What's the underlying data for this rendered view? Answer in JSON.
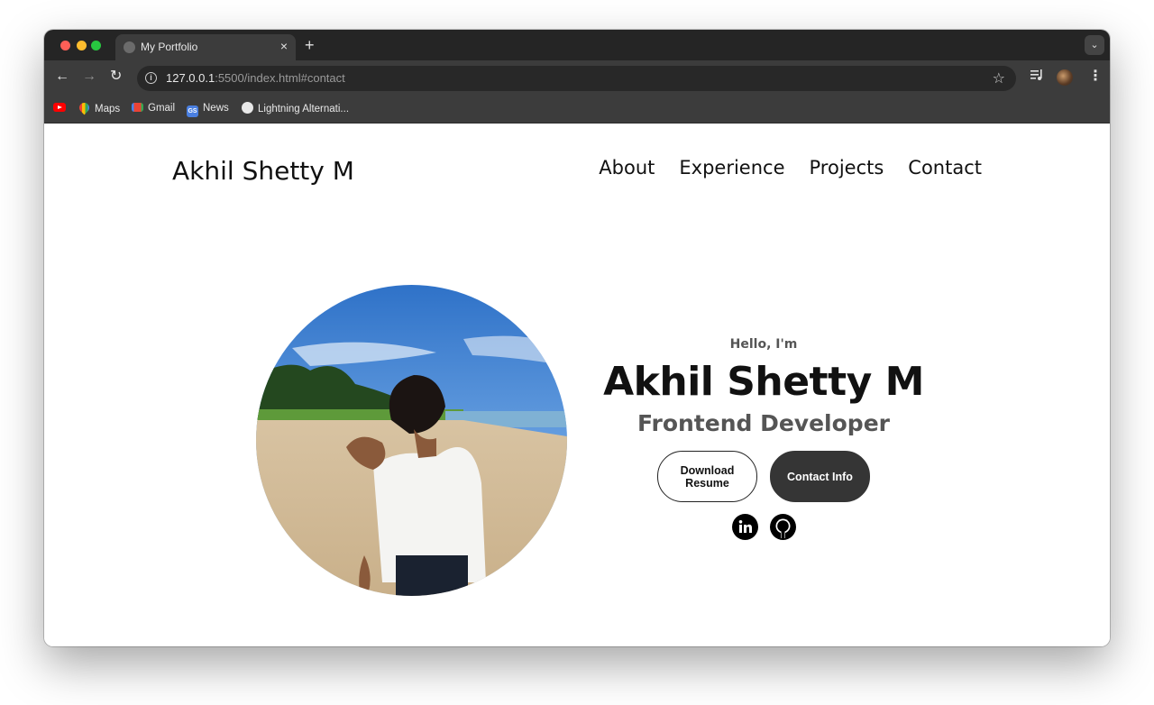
{
  "browser": {
    "tab": {
      "title": "My Portfolio",
      "close": "×"
    },
    "new_tab": "+",
    "tab_menu": "⌄",
    "address": {
      "host": "127.0.0.1",
      "rest": ":5500/index.html#contact"
    },
    "bookmarks": [
      {
        "label": "",
        "icon": "youtube-icon"
      },
      {
        "label": "Maps",
        "icon": "maps-icon"
      },
      {
        "label": "Gmail",
        "icon": "gmail-icon"
      },
      {
        "label": "News",
        "icon": "news-icon"
      },
      {
        "label": "Lightning Alternati...",
        "icon": "globe-icon"
      }
    ],
    "news_icon_text": "GS"
  },
  "site": {
    "logo": "Akhil Shetty M",
    "nav": [
      "About",
      "Experience",
      "Projects",
      "Contact"
    ]
  },
  "hero": {
    "greeting": "Hello, I'm",
    "name": "Akhil Shetty M",
    "role": "Frontend Developer",
    "buttons": {
      "resume": "Download Resume",
      "contact": "Contact Info"
    },
    "socials": [
      "linkedin-icon",
      "github-icon"
    ]
  }
}
